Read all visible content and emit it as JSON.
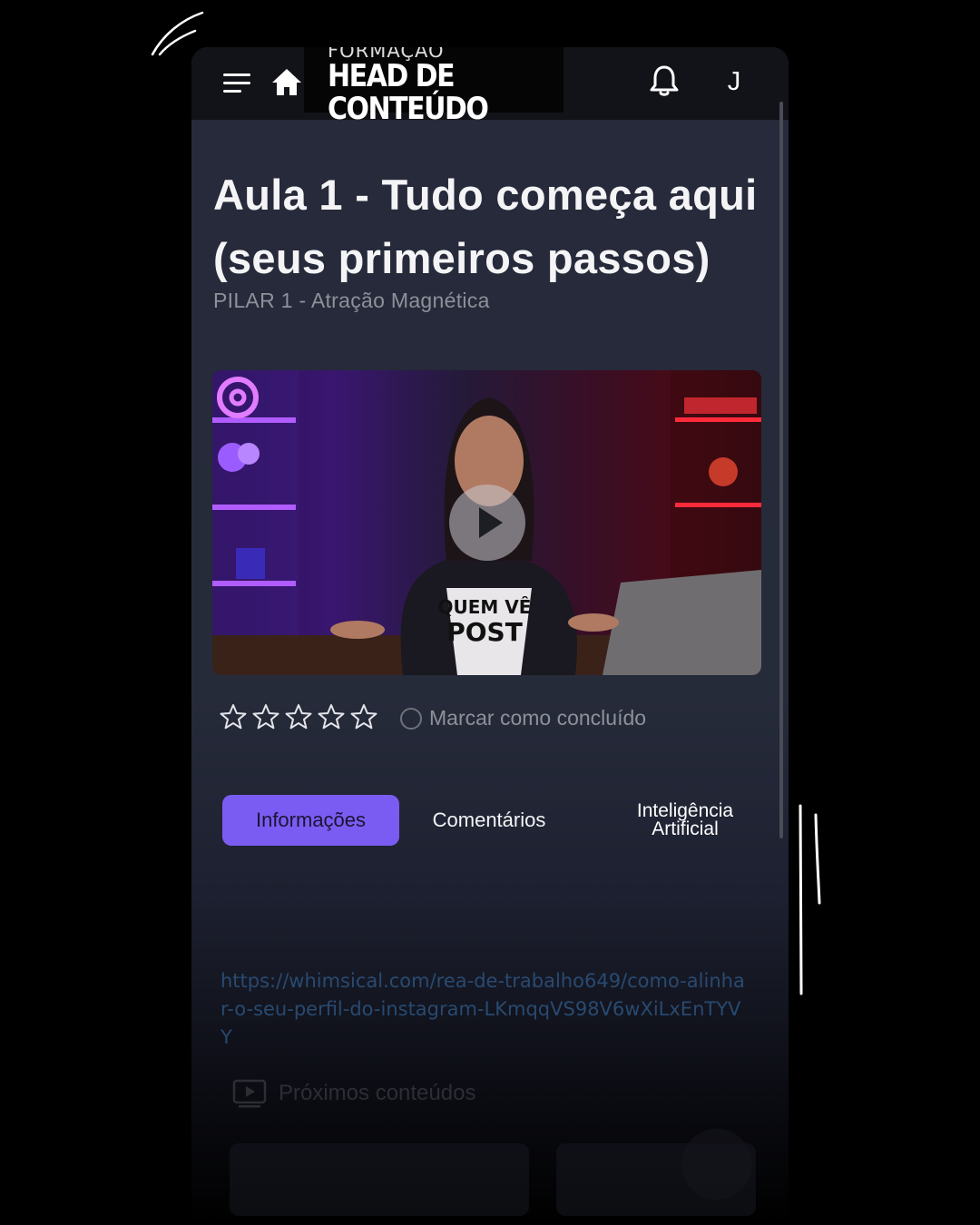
{
  "header": {
    "logo_top": "FORMAÇÃO",
    "logo_main": "HEAD DE CONTEÚDO",
    "avatar_initial": "J",
    "icons": [
      "menu-icon",
      "home-icon",
      "bell-icon"
    ]
  },
  "lesson": {
    "title": "Aula 1 - Tudo começa aqui (seus primeiros passos)",
    "subtitle": "PILAR 1 - Atração Magnética"
  },
  "video": {
    "shirt_line1": "QUEM VÊ",
    "shirt_line2": "POST"
  },
  "rating": {
    "stars_total": 5,
    "stars_filled": 0
  },
  "complete": {
    "label": "Marcar como concluído",
    "checked": false
  },
  "tabs": [
    {
      "label": "Informações",
      "active": true
    },
    {
      "label": "Comentários",
      "active": false
    },
    {
      "label": "Inteligência Artificial",
      "active": false
    }
  ],
  "info": {
    "link": "https://whimsical.com/rea-de-trabalho649/como-alinhar-o-seu-perfil-do-instagram-LKmqqVS98V6wXiLxEnTYVY"
  },
  "next": {
    "label": "Próximos conteúdos"
  },
  "colors": {
    "accent": "#7b5cf2",
    "background": "#262a3a",
    "link": "#2f5c8c"
  }
}
